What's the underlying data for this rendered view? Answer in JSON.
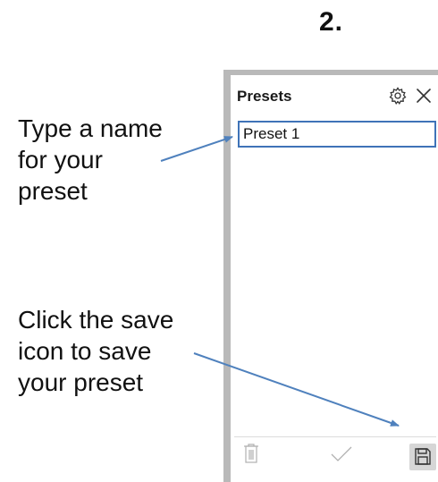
{
  "step": {
    "number": "2."
  },
  "callouts": {
    "name": "Type a name\nfor your\npreset",
    "save": "Click the save\nicon to save\nyour preset"
  },
  "panel": {
    "title": "Presets",
    "name_value": "Preset 1",
    "icons": {
      "settings": "gear-icon",
      "close": "close-icon",
      "delete": "trash-icon",
      "confirm": "checkmark-icon",
      "save": "save-icon"
    }
  },
  "colors": {
    "arrow": "#4f81bd",
    "input_border": "#3f73b8",
    "panel_frame": "#b9b9b9",
    "disabled_icon": "#b0b0b0"
  }
}
